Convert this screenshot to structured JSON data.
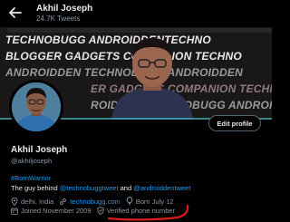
{
  "header": {
    "name": "Akhil Joseph",
    "tweet_count": "24.7K Tweets"
  },
  "banner": {
    "lines": [
      "TECHNOBUGG ANDROIDDENTECHNO",
      "BLOGGER GADGETS COMPANION TECHNO",
      "ANDROIDDEN TECHNOBUGG ANDROIDDEN",
      "ER GADGETS COMPANION TECHNO",
      "ROIDDEN TECHNOBUGG ANDROIDDEN"
    ]
  },
  "profile": {
    "edit_button": "Edit profile",
    "name": "Akhil Joseph",
    "handle": "@akhiljoseph",
    "bio_hashtag": "#BornWarrior",
    "bio_text": "The guy behind ",
    "bio_mention1": "@technobuggtweet",
    "bio_and": " and ",
    "bio_mention2": "@androiddentweet",
    "location": "delhi, India",
    "website": "technobugg.com",
    "birthday": "Born July 12",
    "joined": "Joined November 2009",
    "verified": "Verified phone number"
  },
  "colors": {
    "accent": "#1d9bf0",
    "annotation": "#e01b1b"
  }
}
